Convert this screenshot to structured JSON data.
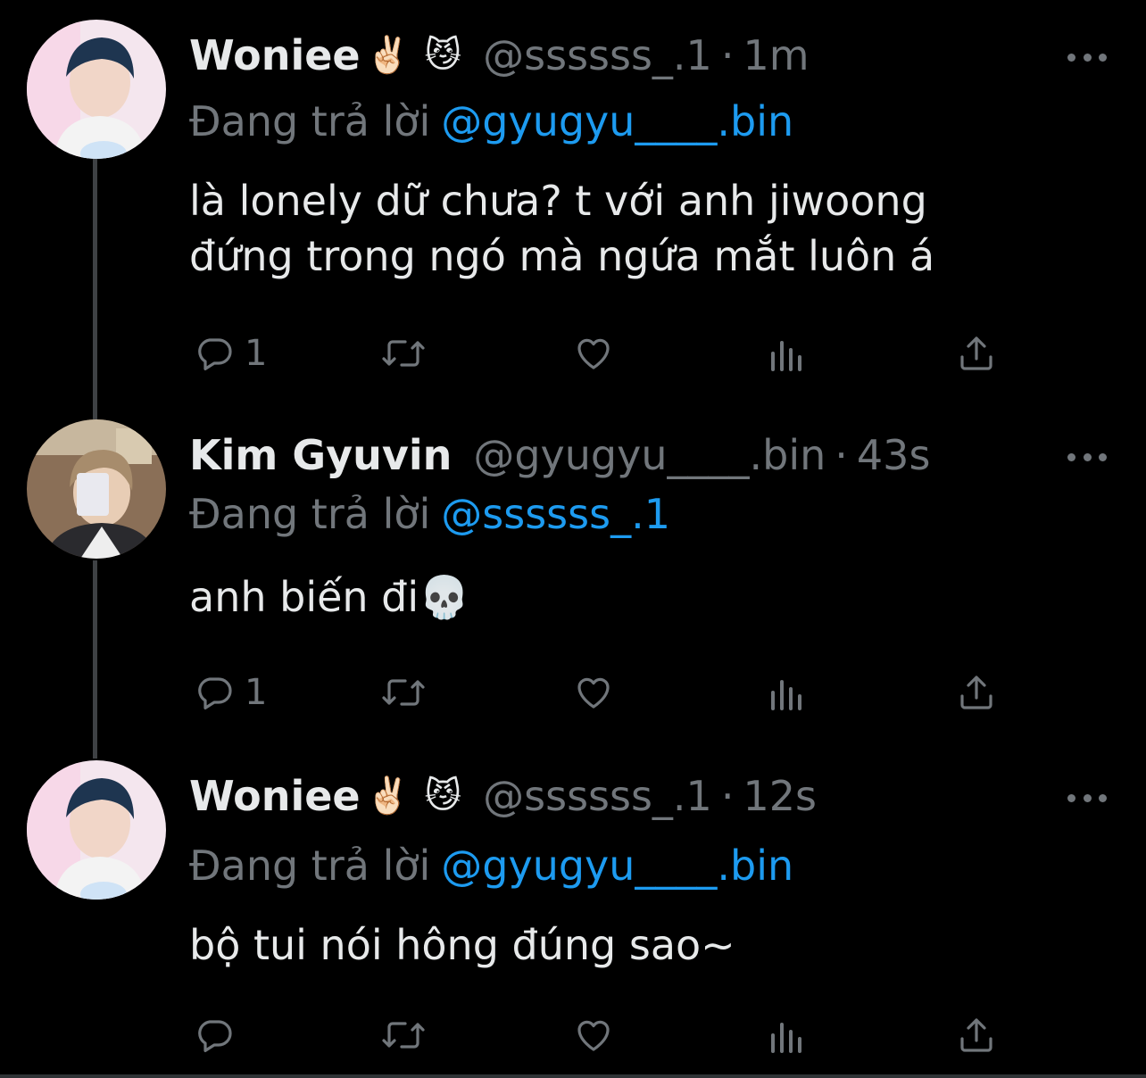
{
  "tweets": [
    {
      "display_name": "Woniee",
      "emoji_1": "✌🏻",
      "emoji_2": "😼",
      "handle": "@ssssss_.1",
      "separator": "·",
      "time": "1m",
      "reply_prefix": "Đang trả lời",
      "reply_to": "@gyugyu____.bin",
      "text": "là lonely dữ chưa? t với anh jiwoong\nđứng trong ngó mà ngứa mắt luôn á",
      "reply_count": "1",
      "avatar_icon": "user-avatar-woniee"
    },
    {
      "display_name": "Kim Gyuvin",
      "handle": "@gyugyu____.bin",
      "separator": "·",
      "time": "43s",
      "reply_prefix": "Đang trả lời",
      "reply_to": "@ssssss_.1",
      "text": "anh biến đi",
      "emoji_text": "💀",
      "reply_count": "1",
      "avatar_icon": "user-avatar-gyuvin"
    },
    {
      "display_name": "Woniee",
      "emoji_1": "✌🏻",
      "emoji_2": "😼",
      "handle": "@ssssss_.1",
      "separator": "·",
      "time": "12s",
      "reply_prefix": "Đang trả lời",
      "reply_to": "@gyugyu____.bin",
      "text": "bộ tui nói hông đúng sao~",
      "reply_count": "",
      "avatar_icon": "user-avatar-woniee"
    }
  ],
  "colors": {
    "background": "#000000",
    "text": "#e7e9ea",
    "muted": "#71767b",
    "link": "#1d9bf0",
    "thread_line": "#3e4144"
  },
  "icons": [
    "reply-icon",
    "retweet-icon",
    "like-icon",
    "views-icon",
    "share-icon",
    "more-icon"
  ]
}
